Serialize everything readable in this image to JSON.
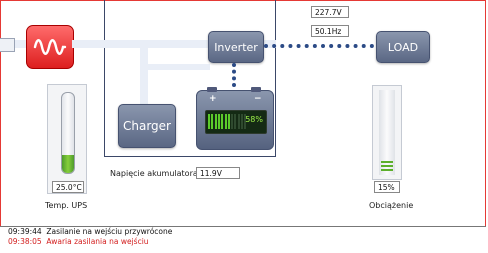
{
  "colors": {
    "accent_red": "#dd1f1f",
    "panel_blue": "#5a6784",
    "battery_green": "#5ccb2a",
    "log_alert": "#d32020"
  },
  "top_readouts": {
    "voltage_partial": "227.7V",
    "frequency": "50.1Hz"
  },
  "diagram": {
    "input_icon": "sine-wave-icon",
    "inverter_label": "Inverter",
    "load_label": "LOAD",
    "charger_label": "Charger",
    "battery": {
      "plus": "+",
      "minus": "−",
      "percent_text": "58%",
      "level_fraction": 0.58
    }
  },
  "battery_voltage": {
    "label": "Napięcie akumulatora",
    "value": "11.9V"
  },
  "temperature": {
    "value": "25.0°C",
    "label": "Temp. UPS",
    "level_fraction": 0.22
  },
  "load": {
    "value": "15%",
    "label": "Obciążenie",
    "level_fraction": 0.15
  },
  "log": [
    {
      "time": "09:39:44",
      "message": "Zasilanie na wejściu przywrócone",
      "color": "#111111"
    },
    {
      "time": "09:38:05",
      "message": "Awaria zasilania na wejściu",
      "color": "#d32020"
    }
  ]
}
